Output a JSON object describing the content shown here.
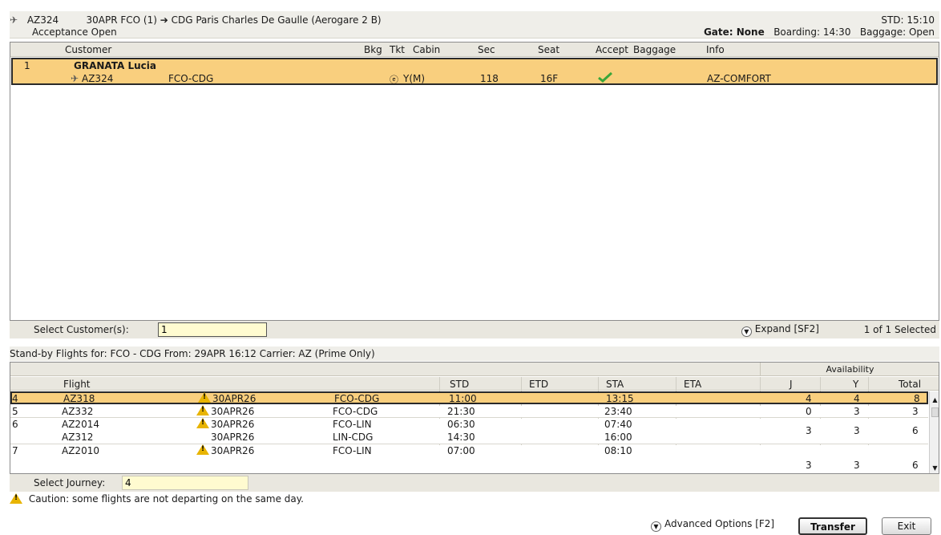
{
  "flight_header": {
    "flight": "AZ324",
    "route": "30APR FCO (1) ➔ CDG Paris Charles De Gaulle (Aerogare 2  B)",
    "status": "Acceptance Open",
    "std": "STD: 15:10",
    "gate": "Gate: None",
    "boarding": "Boarding: 14:30",
    "baggage": "Baggage: Open"
  },
  "customers": {
    "columns": [
      "Customer",
      "Bkg",
      "Tkt",
      "Cabin",
      "Sec",
      "Seat",
      "Accept",
      "Baggage",
      "Info"
    ],
    "rows": [
      {
        "num": "1",
        "name": "GRANATA Lucia",
        "flight": "AZ324",
        "route": "FCO-CDG",
        "tkt_icon": "e-ticket-icon",
        "cabin": "Y(M)",
        "sec": "118",
        "seat": "16F",
        "accepted_icon": "checkmark-icon",
        "info": "AZ-COMFORT"
      }
    ]
  },
  "select_customer": {
    "label": "Select Customer(s):",
    "value": "1",
    "expand_label": "Expand [SF2]",
    "selected_count": "1 of 1 Selected"
  },
  "standby": {
    "title": "Stand-by Flights for: FCO - CDG   From: 29APR 16:12   Carrier: AZ (Prime Only)",
    "availability_label": "Availability",
    "columns": [
      "Flight",
      "STD",
      "ETD",
      "STA",
      "ETA",
      "J",
      "Y",
      "Total"
    ],
    "rows": [
      {
        "num": "4",
        "legs": [
          {
            "flight": "AZ318",
            "warn": true,
            "date": "30APR26",
            "route": "FCO-CDG",
            "std": "11:00",
            "sta": "13:15"
          }
        ],
        "j": "4",
        "y": "4",
        "total": "8"
      },
      {
        "num": "5",
        "legs": [
          {
            "flight": "AZ332",
            "warn": true,
            "date": "30APR26",
            "route": "FCO-CDG",
            "std": "21:30",
            "sta": "23:40"
          }
        ],
        "j": "0",
        "y": "3",
        "total": "3"
      },
      {
        "num": "6",
        "legs": [
          {
            "flight": "AZ2014",
            "warn": true,
            "date": "30APR26",
            "route": "FCO-LIN",
            "std": "06:30",
            "sta": "07:40"
          },
          {
            "flight": "AZ312",
            "warn": false,
            "date": "30APR26",
            "route": "LIN-CDG",
            "std": "14:30",
            "sta": "16:00"
          }
        ],
        "j": "3",
        "y": "3",
        "total": "6"
      },
      {
        "num": "7",
        "legs": [
          {
            "flight": "AZ2010",
            "warn": true,
            "date": "30APR26",
            "route": "FCO-LIN",
            "std": "07:00",
            "sta": "08:10"
          }
        ],
        "j": "3",
        "y": "3",
        "total": "6"
      }
    ]
  },
  "select_journey": {
    "label": "Select Journey:",
    "value": "4"
  },
  "caution": "Caution: some flights are not departing on the same day.",
  "footer": {
    "advanced_label": "Advanced Options [F2]",
    "transfer_label": "Transfer",
    "exit_label": "Exit"
  },
  "colors": {
    "selected_row": "#f9cf7e",
    "panel_bg": "#e9e7df",
    "input_bg": "#fffbd0",
    "warning": "#e8b400",
    "check": "#3aa63a"
  }
}
